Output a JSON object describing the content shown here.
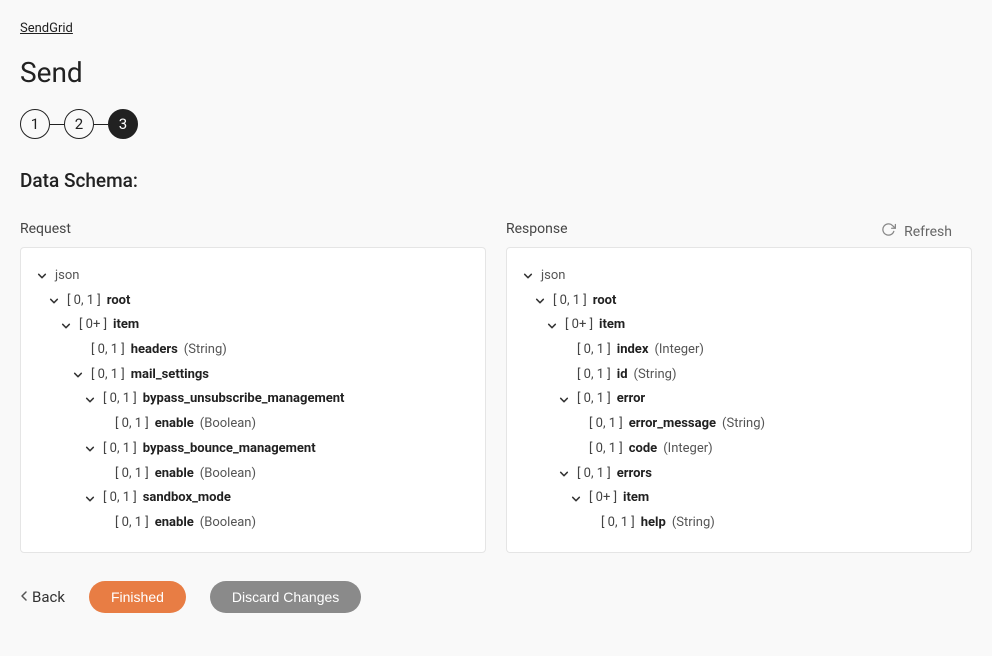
{
  "breadcrumb": "SendGrid",
  "page_title": "Send",
  "stepper": {
    "steps": [
      "1",
      "2",
      "3"
    ],
    "active_index": 2
  },
  "section_title": "Data Schema:",
  "refresh_label": "Refresh",
  "request_label": "Request",
  "response_label": "Response",
  "request_tree": [
    {
      "indent": 0,
      "chevron": true,
      "range": "",
      "name": "json",
      "type": "",
      "name_bold": false
    },
    {
      "indent": 1,
      "chevron": true,
      "range": "[ 0, 1 ]",
      "name": "root",
      "type": ""
    },
    {
      "indent": 2,
      "chevron": true,
      "range": "[ 0+ ]",
      "name": "item",
      "type": ""
    },
    {
      "indent": 3,
      "chevron": false,
      "range": "[ 0, 1 ]",
      "name": "headers",
      "type": "(String)"
    },
    {
      "indent": 3,
      "chevron": true,
      "range": "[ 0, 1 ]",
      "name": "mail_settings",
      "type": ""
    },
    {
      "indent": 4,
      "chevron": true,
      "range": "[ 0, 1 ]",
      "name": "bypass_unsubscribe_management",
      "type": ""
    },
    {
      "indent": 5,
      "chevron": false,
      "range": "[ 0, 1 ]",
      "name": "enable",
      "type": "(Boolean)"
    },
    {
      "indent": 4,
      "chevron": true,
      "range": "[ 0, 1 ]",
      "name": "bypass_bounce_management",
      "type": ""
    },
    {
      "indent": 5,
      "chevron": false,
      "range": "[ 0, 1 ]",
      "name": "enable",
      "type": "(Boolean)"
    },
    {
      "indent": 4,
      "chevron": true,
      "range": "[ 0, 1 ]",
      "name": "sandbox_mode",
      "type": ""
    },
    {
      "indent": 5,
      "chevron": false,
      "range": "[ 0, 1 ]",
      "name": "enable",
      "type": "(Boolean)"
    }
  ],
  "response_tree": [
    {
      "indent": 0,
      "chevron": true,
      "range": "",
      "name": "json",
      "type": "",
      "name_bold": false
    },
    {
      "indent": 1,
      "chevron": true,
      "range": "[ 0, 1 ]",
      "name": "root",
      "type": ""
    },
    {
      "indent": 2,
      "chevron": true,
      "range": "[ 0+ ]",
      "name": "item",
      "type": ""
    },
    {
      "indent": 3,
      "chevron": false,
      "range": "[ 0, 1 ]",
      "name": "index",
      "type": "(Integer)"
    },
    {
      "indent": 3,
      "chevron": false,
      "range": "[ 0, 1 ]",
      "name": "id",
      "type": "(String)"
    },
    {
      "indent": 3,
      "chevron": true,
      "range": "[ 0, 1 ]",
      "name": "error",
      "type": ""
    },
    {
      "indent": 4,
      "chevron": false,
      "range": "[ 0, 1 ]",
      "name": "error_message",
      "type": "(String)"
    },
    {
      "indent": 4,
      "chevron": false,
      "range": "[ 0, 1 ]",
      "name": "code",
      "type": "(Integer)"
    },
    {
      "indent": 3,
      "chevron": true,
      "range": "[ 0, 1 ]",
      "name": "errors",
      "type": ""
    },
    {
      "indent": 4,
      "chevron": true,
      "range": "[ 0+ ]",
      "name": "item",
      "type": ""
    },
    {
      "indent": 5,
      "chevron": false,
      "range": "[ 0, 1 ]",
      "name": "help",
      "type": "(String)"
    }
  ],
  "footer": {
    "back": "Back",
    "finished": "Finished",
    "discard": "Discard Changes"
  }
}
